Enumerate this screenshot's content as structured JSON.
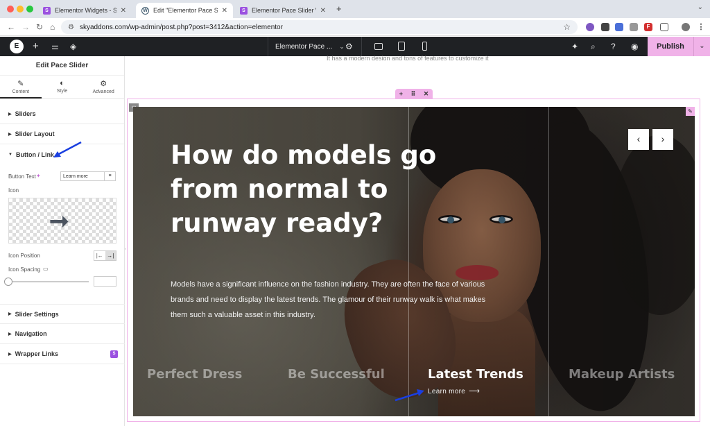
{
  "browser": {
    "tabs": [
      {
        "title": "Elementor Widgets - Sky Add",
        "icon": "sky-addons-favicon"
      },
      {
        "title": "Edit \"Elementor Pace Slider W",
        "icon": "wordpress-favicon"
      },
      {
        "title": "Elementor Pace Slider Widge",
        "icon": "sky-addons-favicon"
      }
    ],
    "url": "skyaddons.com/wp-admin/post.php?post=3412&action=elementor",
    "new_tab": "+"
  },
  "editor": {
    "logo": "E",
    "document_title": "Elementor Pace ...",
    "publish_label": "Publish"
  },
  "panel": {
    "title": "Edit Pace Slider",
    "tabs": [
      {
        "label": "Content",
        "icon": "pencil-icon"
      },
      {
        "label": "Style",
        "icon": "contrast-icon"
      },
      {
        "label": "Advanced",
        "icon": "gear-icon"
      }
    ],
    "sections_top": [
      "Sliders",
      "Slider Layout",
      "Button / Link"
    ],
    "button_text_label": "Button Text",
    "button_text_value": "Learn more",
    "icon_label": "Icon",
    "icon_position_label": "Icon Position",
    "icon_spacing_label": "Icon Spacing",
    "sections_bottom": [
      "Slider Settings",
      "Navigation",
      "Wrapper Links"
    ]
  },
  "canvas": {
    "above_text": "It has a modern design and tons of features to customize it",
    "hero_title": "How do models go from normal to runway ready?",
    "hero_description": "Models have a significant influence on the fashion industry. They are often the face of various brands and need to display the latest trends. The glamour of their runway walk is what makes them such a valuable asset in this industry.",
    "slide_labels": [
      "Perfect Dress",
      "Be Successful",
      "Latest Trends",
      "Makeup Artists"
    ],
    "active_slide": 2,
    "learn_more": "Learn more",
    "prev_arrow": "‹",
    "next_arrow": "›"
  },
  "colors": {
    "accent_pink": "#f0b2e8",
    "editor_bar": "#1f2124",
    "annotation_arrow": "#1a3fe0"
  }
}
